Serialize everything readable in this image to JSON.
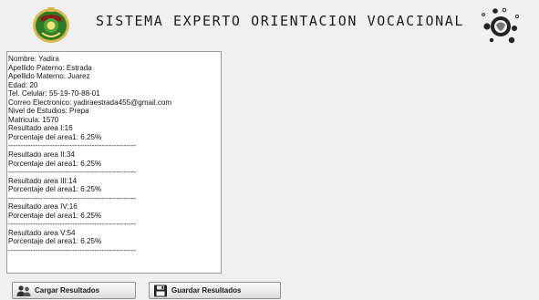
{
  "header": {
    "title": "SISTEMA EXPERTO ORIENTACION VOCACIONAL",
    "logo_icon": "university-crest-icon",
    "gear_icon": "brain-gear-icon"
  },
  "results": {
    "text": "Nombre: Yadira\nApellido Paterno: Estrada\nApellido Materno: Juarez\nEdad: 20\nTel. Celular: 55-19-70-88-01\nCorreo Electronico: yadiraestrada455@gmail.com\nNivel de Estudios: Prepa\nMatricula: 1570\nResultado area I:16\nPorcentaje del area1: 6.25%\n----------------------------------------------------\nResultado area II:34\nPorcentaje del area1: 6.25%\n----------------------------------------------------\nResultado area III:14\nPorcentaje del area1: 6.25%\n----------------------------------------------------\nResultado area IV:16\nPorcentaje del area1: 6.25%\n----------------------------------------------------\nResultado area V:54\nPorcentaje del area1: 6.25%\n----------------------------------------------------"
  },
  "buttons": {
    "load_label": "Cargar Resultados",
    "load_icon": "users-icon",
    "save_label": "Guardar Resultados",
    "save_icon": "floppy-disk-icon"
  },
  "colors": {
    "crest_green": "#3c8a2e",
    "crest_gold": "#d9b84a",
    "gear_dark": "#222222"
  }
}
